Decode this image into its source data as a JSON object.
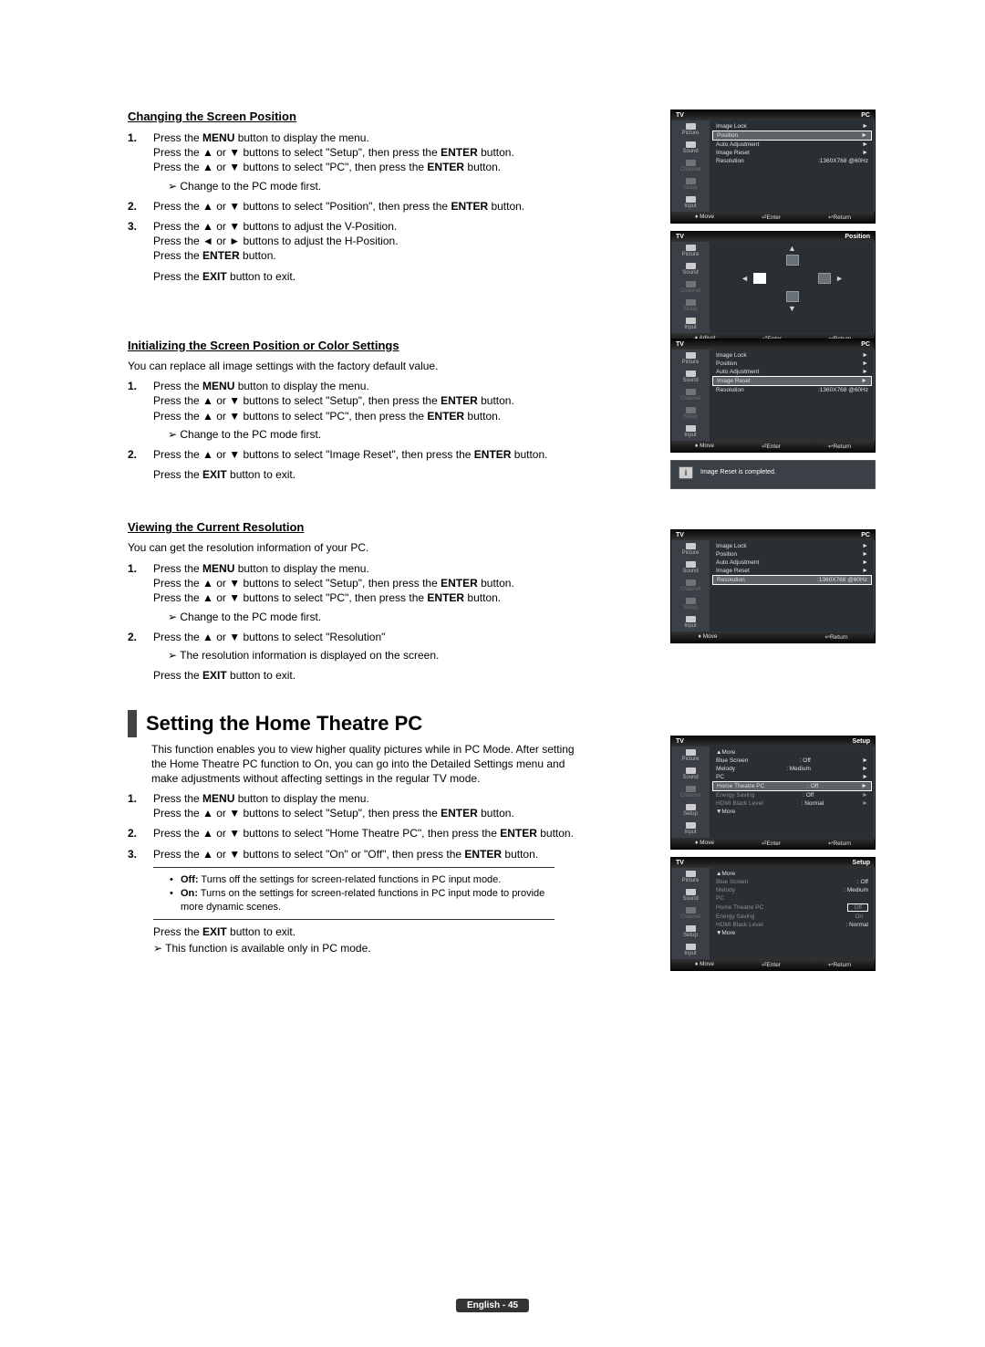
{
  "sections": {
    "changing": {
      "head": "Changing the Screen Position",
      "s1a": "Press the ",
      "s1b": "MENU",
      "s1c": " button to display the menu.",
      "s1d": "Press the ▲ or ▼ buttons to select \"Setup\", then press the ",
      "s1e": "ENTER",
      "s1f": " button.",
      "s1g": "Press the ▲ or ▼ buttons to select \"PC\", then press the ",
      "s1h": "ENTER",
      "s1i": " button.",
      "s1note": "Change to the PC mode first.",
      "s2a": "Press the ▲ or ▼ buttons to select \"Position\", then press the ",
      "s2b": "ENTER",
      "s2c": " button.",
      "s3a": "Press the ▲ or ▼ buttons to adjust the V-Position.",
      "s3b": "Press the ◄ or ► buttons to adjust the H-Position.",
      "s3c": "Press the ",
      "s3d": "ENTER",
      "s3e": " button.",
      "s3f": "Press the ",
      "s3g": "EXIT",
      "s3h": " button to exit."
    },
    "init": {
      "head": "Initializing the Screen Position or Color Settings",
      "intro": "You can replace all image settings with the factory default value.",
      "s1a": "Press the ",
      "s1b": "MENU",
      "s1c": " button to display the menu.",
      "s1d": "Press the ▲ or ▼ buttons to select \"Setup\", then press the ",
      "s1e": "ENTER",
      "s1f": " button.",
      "s1g": "Press the ▲ or ▼ buttons to select \"PC\", then press the ",
      "s1h": "ENTER",
      "s1i": " button.",
      "s1note": "Change to the PC mode first.",
      "s2a": "Press the ▲ or ▼ buttons to select \"Image Reset\", then press the ",
      "s2b": "ENTER",
      "s2c": " button.",
      "s2d": "Press the ",
      "s2e": "EXIT",
      "s2f": " button to exit.",
      "msg": "Image Reset is completed."
    },
    "viewing": {
      "head": "Viewing the Current Resolution",
      "intro": "You can get the resolution information of your PC.",
      "s1a": "Press the ",
      "s1b": "MENU",
      "s1c": " button to display the menu.",
      "s1d": "Press the ▲ or ▼ buttons to select \"Setup\", then press the ",
      "s1e": "ENTER",
      "s1f": " button.",
      "s1g": "Press the ▲ or ▼ buttons to select \"PC\", then press the ",
      "s1h": "ENTER",
      "s1i": " button.",
      "s1note": "Change to the PC mode first.",
      "s2a": "Press the ▲ or ▼ buttons to select \"Resolution\"",
      "s2note": "The resolution information is displayed on the screen.",
      "s2b": "Press the ",
      "s2c": "EXIT",
      "s2d": " button to exit."
    },
    "htpc": {
      "title": "Setting the Home Theatre PC",
      "intro": "This function enables you to view higher quality pictures while in PC Mode. After setting the Home Theatre PC function to On, you can go into the Detailed Settings menu and make adjustments without affecting settings in the regular TV mode.",
      "s1a": "Press the ",
      "s1b": "MENU",
      "s1c": " button to display the menu.",
      "s1d": "Press the ▲ or ▼ buttons to select \"Setup\", then press the ",
      "s1e": "ENTER",
      "s1f": " button.",
      "s2a": "Press the ▲ or ▼ buttons to select \"Home Theatre PC\", then press the ",
      "s2b": "ENTER",
      "s2c": " button.",
      "s3a": "Press the ▲ or ▼ buttons to select \"On\" or \"Off\", then press the ",
      "s3b": "ENTER",
      "s3c": " button.",
      "b1a": "Off:",
      "b1b": " Turns off the settings for screen-related functions in PC input mode.",
      "b2a": "On:",
      "b2b": " Turns on the settings for screen-related functions in PC input mode to provide more dynamic scenes.",
      "exita": "Press the ",
      "exitb": "EXIT",
      "exitc": " button to exit.",
      "note": "This function is available only in PC mode."
    }
  },
  "osd": {
    "tv": "TV",
    "side": [
      "Picture",
      "Sound",
      "Channel",
      "Setup",
      "Input"
    ],
    "pc_head": "PC",
    "position_head": "Position",
    "setup_head": "Setup",
    "rows_pc": {
      "image_lock": "Image Lock",
      "position": "Position",
      "auto_adj": "Auto Adjustment",
      "image_reset": "Image Reset",
      "resolution": "Resolution",
      "res_val": ":1360X768 @60Hz"
    },
    "rows_setup": {
      "more_up": "▲More",
      "blue": "Blue Screen",
      "blue_v": ": Off",
      "melody": "Melody",
      "melody_v": ": Medium",
      "pc": "PC",
      "htpc": "Home Theatre PC",
      "htpc_v": ": Off",
      "energy": "Energy Saving",
      "energy_v": ": Off",
      "hdmi": "HDMI Black Level",
      "hdmi_v": ": Normal",
      "more_dn": "▼More",
      "opt_off": "Off",
      "opt_on": "On"
    },
    "foot": {
      "move": "Move",
      "enter": "Enter",
      "return": "Return",
      "adjust": "Adjust"
    },
    "msg": "Image Reset is completed."
  },
  "footer": "English - 45"
}
